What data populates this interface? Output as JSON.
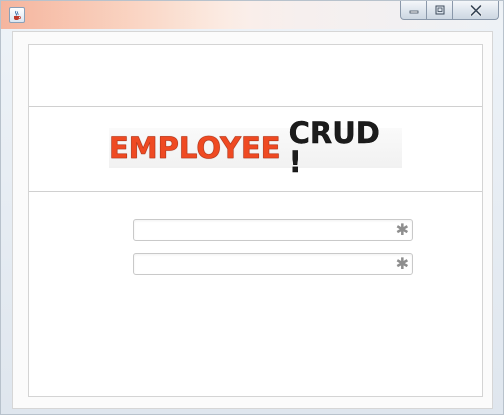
{
  "window": {
    "title": "",
    "icon": "java-cup-icon",
    "controls": [
      "minimize-icon",
      "maximize-icon",
      "close-icon"
    ]
  },
  "banner": {
    "word1": "EMPLOYEE",
    "word2": "CRUD !",
    "colors": {
      "word1": "#ef4a22",
      "word2": "#1c1c1c"
    }
  },
  "form": {
    "fields": [
      {
        "value": "",
        "placeholder": "",
        "required_marker": "✱"
      },
      {
        "value": "",
        "placeholder": "",
        "required_marker": "✱"
      }
    ]
  }
}
